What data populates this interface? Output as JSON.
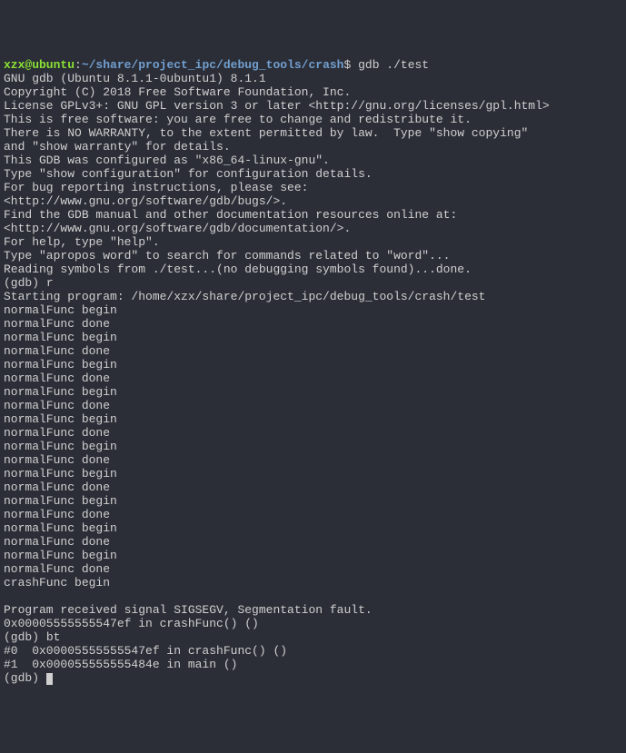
{
  "prompt": {
    "user": "xzx@ubuntu",
    "separator": ":",
    "path": "~/share/project_ipc/debug_tools/crash",
    "dollar": "$",
    "command": " gdb ./test"
  },
  "gdb_banner": [
    "GNU gdb (Ubuntu 8.1.1-0ubuntu1) 8.1.1",
    "Copyright (C) 2018 Free Software Foundation, Inc.",
    "License GPLv3+: GNU GPL version 3 or later <http://gnu.org/licenses/gpl.html>",
    "This is free software: you are free to change and redistribute it.",
    "There is NO WARRANTY, to the extent permitted by law.  Type \"show copying\"",
    "and \"show warranty\" for details.",
    "This GDB was configured as \"x86_64-linux-gnu\".",
    "Type \"show configuration\" for configuration details.",
    "For bug reporting instructions, please see:",
    "<http://www.gnu.org/software/gdb/bugs/>.",
    "Find the GDB manual and other documentation resources online at:",
    "<http://www.gnu.org/software/gdb/documentation/>.",
    "For help, type \"help\".",
    "Type \"apropos word\" to search for commands related to \"word\"...",
    "Reading symbols from ./test...(no debugging symbols found)...done."
  ],
  "gdb_session": {
    "prompt1": "(gdb) ",
    "cmd1": "r",
    "starting": "Starting program: /home/xzx/share/project_ipc/debug_tools/crash/test",
    "func_output": [
      "normalFunc begin",
      "normalFunc done",
      "normalFunc begin",
      "normalFunc done",
      "normalFunc begin",
      "normalFunc done",
      "normalFunc begin",
      "normalFunc done",
      "normalFunc begin",
      "normalFunc done",
      "normalFunc begin",
      "normalFunc done",
      "normalFunc begin",
      "normalFunc done",
      "normalFunc begin",
      "normalFunc done",
      "normalFunc begin",
      "normalFunc done",
      "normalFunc begin",
      "normalFunc done",
      "crashFunc begin"
    ],
    "blank": "",
    "signal": "Program received signal SIGSEGV, Segmentation fault.",
    "crash_loc": "0x00005555555547ef in crashFunc() ()",
    "prompt2": "(gdb) ",
    "cmd2": "bt",
    "backtrace": [
      "#0  0x00005555555547ef in crashFunc() ()",
      "#1  0x000055555555484e in main ()"
    ],
    "prompt3": "(gdb) "
  }
}
